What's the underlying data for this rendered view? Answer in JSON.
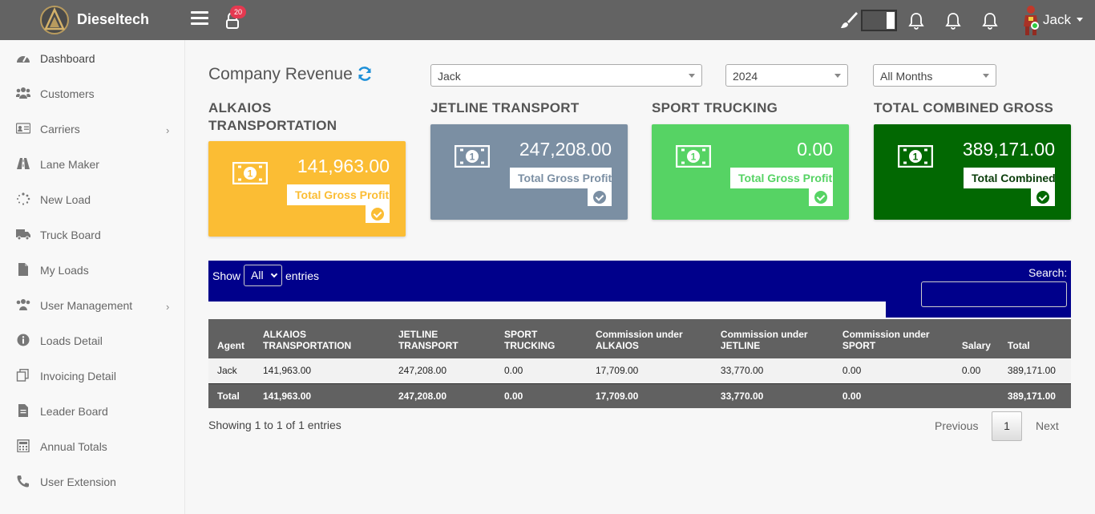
{
  "app": {
    "name": "Dieseltech",
    "notification_count": "20",
    "user": "Jack"
  },
  "sidebar": {
    "items": [
      {
        "label": "Dashboard",
        "icon": "dashboard-icon"
      },
      {
        "label": "Customers",
        "icon": "users-icon"
      },
      {
        "label": "Carriers",
        "icon": "id-card-icon",
        "has_submenu": true
      },
      {
        "label": "Lane Maker",
        "icon": "road-icon"
      },
      {
        "label": "New Load",
        "icon": "spinner-icon"
      },
      {
        "label": "Truck Board",
        "icon": "truck-icon"
      },
      {
        "label": "My Loads",
        "icon": "file-icon"
      },
      {
        "label": "User Management",
        "icon": "users-cog-icon",
        "has_submenu": true
      },
      {
        "label": "Loads Detail",
        "icon": "info-icon"
      },
      {
        "label": "Invoicing Detail",
        "icon": "copy-icon"
      },
      {
        "label": "Leader Board",
        "icon": "file-alt-icon"
      },
      {
        "label": "Annual Totals",
        "icon": "calculator-icon"
      },
      {
        "label": "User Extension",
        "icon": "phone-icon"
      }
    ]
  },
  "main": {
    "title": "Company Revenue",
    "filters": {
      "agent": "Jack",
      "year": "2024",
      "month": "All Months"
    },
    "cards": [
      {
        "title": "ALKAIOS TRANSPORTATION",
        "amount": "141,963.00",
        "badge": "Total Gross Profit",
        "color": "#fbbd34"
      },
      {
        "title": "JETLINE TRANSPORT",
        "amount": "247,208.00",
        "badge": "Total Gross Profit",
        "color": "#7b8fa3"
      },
      {
        "title": "SPORT TRUCKING",
        "amount": "0.00",
        "badge": "Total Gross Profit",
        "color": "#56d364"
      },
      {
        "title": "TOTAL COMBINED GROSS",
        "amount": "389,171.00",
        "badge": "Total Combined",
        "color": "#026802"
      }
    ]
  },
  "table": {
    "show_label": "Show",
    "page_length": "All",
    "entries_label": "entries",
    "search_label": "Search:",
    "columns": [
      "Agent",
      "ALKAIOS TRANSPORTATION",
      "JETLINE TRANSPORT",
      "SPORT TRUCKING",
      "Commission under ALKAIOS",
      "Commission under JETLINE",
      "Commission under SPORT",
      "Salary",
      "Total"
    ],
    "rows": [
      [
        "Jack",
        "141,963.00",
        "247,208.00",
        "0.00",
        "17,709.00",
        "33,770.00",
        "0.00",
        "0.00",
        "389,171.00"
      ]
    ],
    "footer": [
      "Total",
      "141,963.00",
      "247,208.00",
      "0.00",
      "17,709.00",
      "33,770.00",
      "0.00",
      "",
      "389,171.00"
    ],
    "info": "Showing 1 to 1 of 1 entries",
    "pagination": {
      "previous": "Previous",
      "current": "1",
      "next": "Next"
    }
  }
}
